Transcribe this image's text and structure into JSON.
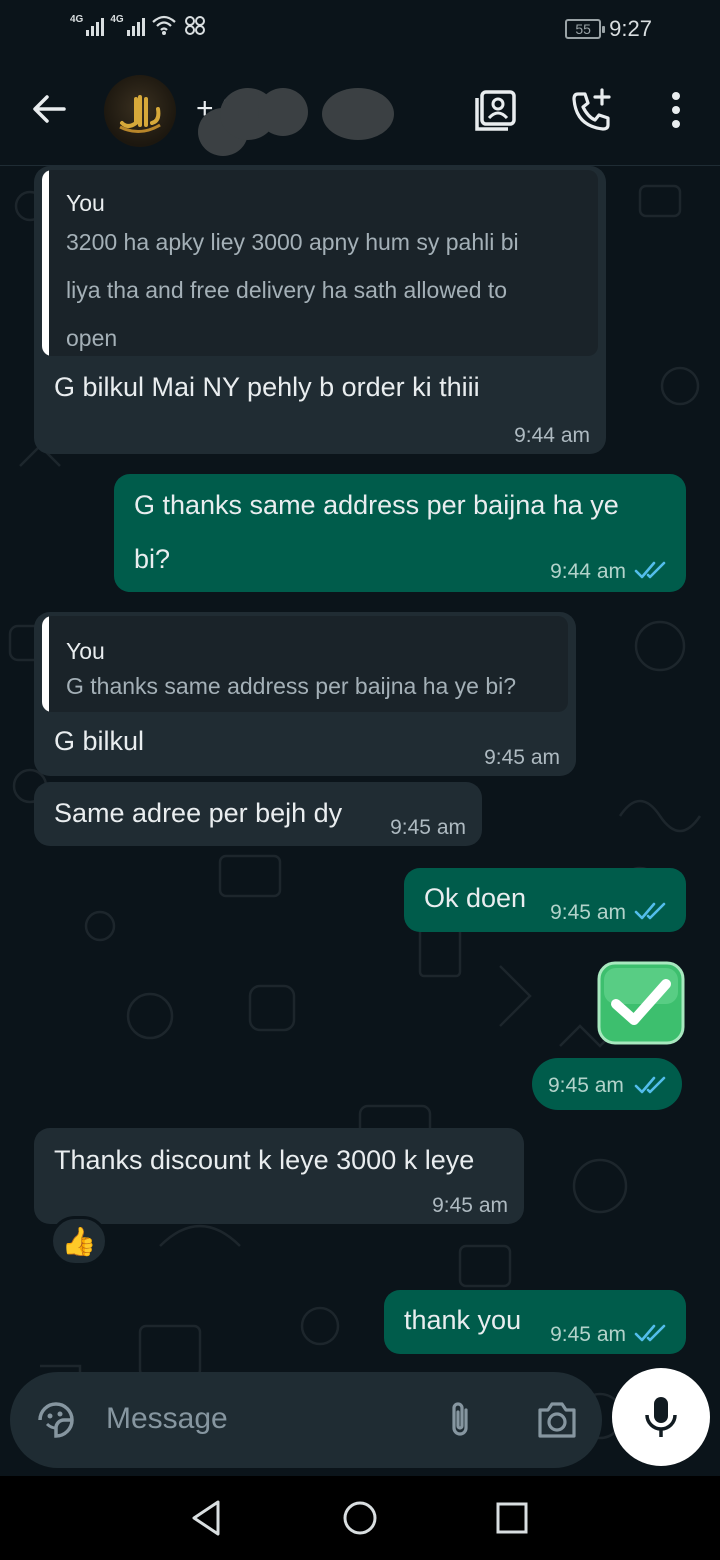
{
  "status_bar": {
    "sim1": "4G",
    "sim2": "4G",
    "battery": "55",
    "time": "9:27"
  },
  "header": {
    "contact_name": "+ 2 7...",
    "icons": [
      "back-arrow-icon",
      "contact-card-icon",
      "add-call-icon",
      "more-vertical-icon"
    ]
  },
  "messages": [
    {
      "direction": "incoming",
      "quote_author": "You",
      "quote_lines": [
        "3200 ha apky liey 3000 apny hum sy pahli bi",
        "liya tha and free delivery ha sath allowed to",
        "open"
      ],
      "text": "G bilkul Mai NY pehly b order ki thiii",
      "time": "9:44 am"
    },
    {
      "direction": "outgoing",
      "text_lines": [
        "G thanks same address per baijna ha ye",
        "bi?"
      ],
      "time": "9:44 am",
      "status": "read"
    },
    {
      "direction": "incoming",
      "quote_author": "You",
      "quote_lines": [
        "G thanks same address per baijna ha ye bi?"
      ],
      "text": "G bilkul",
      "time": "9:45 am"
    },
    {
      "direction": "incoming",
      "text": "Same adree per bejh dy",
      "time": "9:45 am"
    },
    {
      "direction": "outgoing",
      "text": "Ok doen",
      "time": "9:45 am",
      "status": "read"
    },
    {
      "direction": "outgoing",
      "sticker": "check-mark-sticker",
      "time": "9:45 am",
      "status": "read"
    },
    {
      "direction": "incoming",
      "text": "Thanks discount k leye 3000 k leye",
      "time": "9:45 am",
      "reaction": "👍"
    },
    {
      "direction": "outgoing",
      "text": "thank you",
      "time": "9:45 am",
      "status": "read"
    }
  ],
  "composer": {
    "placeholder": "Message",
    "icons": [
      "sticker-icon",
      "attachment-icon",
      "camera-icon",
      "microphone-icon"
    ]
  },
  "nav": {
    "icons": [
      "nav-back-icon",
      "nav-home-icon",
      "nav-recents-icon"
    ]
  },
  "colors": {
    "background": "#0b141a",
    "incoming_bubble": "#202c33",
    "outgoing_bubble": "#005c4b",
    "read_ticks": "#53bdeb"
  }
}
